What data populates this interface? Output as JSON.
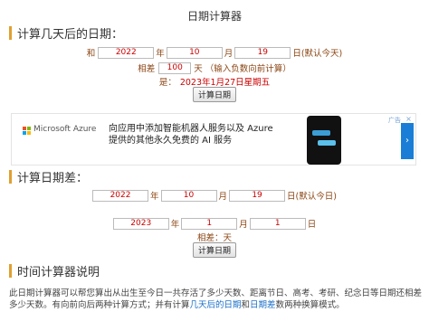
{
  "page_title": "日期计算器",
  "section1": {
    "heading": "计算几天后的日期：",
    "prefix": "和",
    "year": "2022",
    "year_unit": "年",
    "month": "10",
    "month_unit": "月",
    "day": "19",
    "day_unit": "日(默认今天)",
    "diff_label": "相差",
    "diff_value": "100",
    "diff_unit": "天 （输入负数向前计算）",
    "result_label": "是：",
    "result_value": "2023年1月27日星期五",
    "button": "计算日期"
  },
  "ad": {
    "brand": "Microsoft Azure",
    "line1": "向应用中添加智能机器人服务以及 Azure",
    "line2": "提供的其他永久免费的 AI 服务",
    "badge": "广告",
    "close": "×",
    "arrow": "›"
  },
  "section2": {
    "heading": "计算日期差：",
    "date1": {
      "year": "2022",
      "year_unit": "年",
      "month": "10",
      "month_unit": "月",
      "day": "19",
      "day_unit": "日(默认今日)"
    },
    "date2": {
      "year": "2023",
      "year_unit": "年",
      "month": "1",
      "month_unit": "月",
      "day": "1",
      "day_unit": "日"
    },
    "diff_text": "相差：天",
    "button": "计算日期"
  },
  "section3": {
    "heading": "时间计算器说明",
    "desc_part1": "此日期计算器可以帮您算出从出生至今日一共存活了多少天数、距离节日、高考、考研、纪念日等日期还相差多少天数。有向前向后两种计算方式；并有计算",
    "link1": "几天后的日期",
    "desc_part2": "和",
    "link2": "日期差",
    "desc_part3": "数两种换算模式。"
  },
  "colors": {
    "accent_bar": "#e0a030",
    "label": "#8b4513",
    "value": "#cc0000",
    "link": "#1a6fc9"
  }
}
